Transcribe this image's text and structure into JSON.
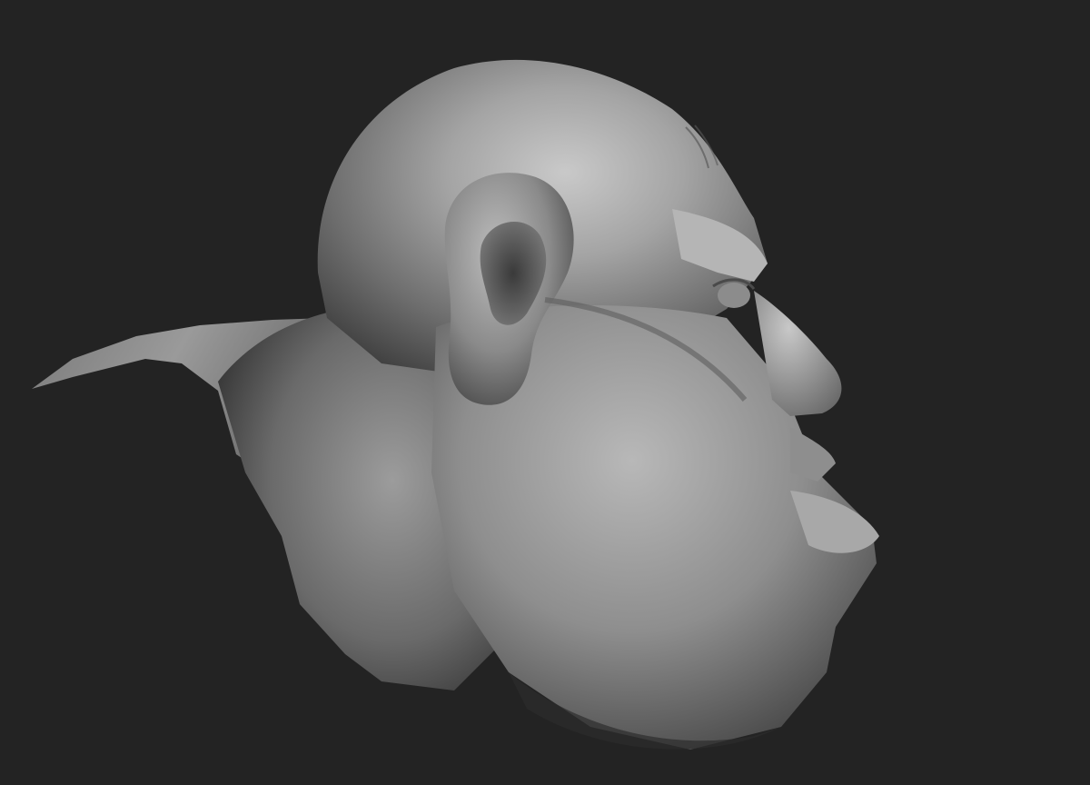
{
  "viewport": {
    "background": "#232323",
    "subject": "sculpted-head-side-profile",
    "material_color": "#9a9a9a",
    "shadow_color": "#3a3a3a"
  }
}
